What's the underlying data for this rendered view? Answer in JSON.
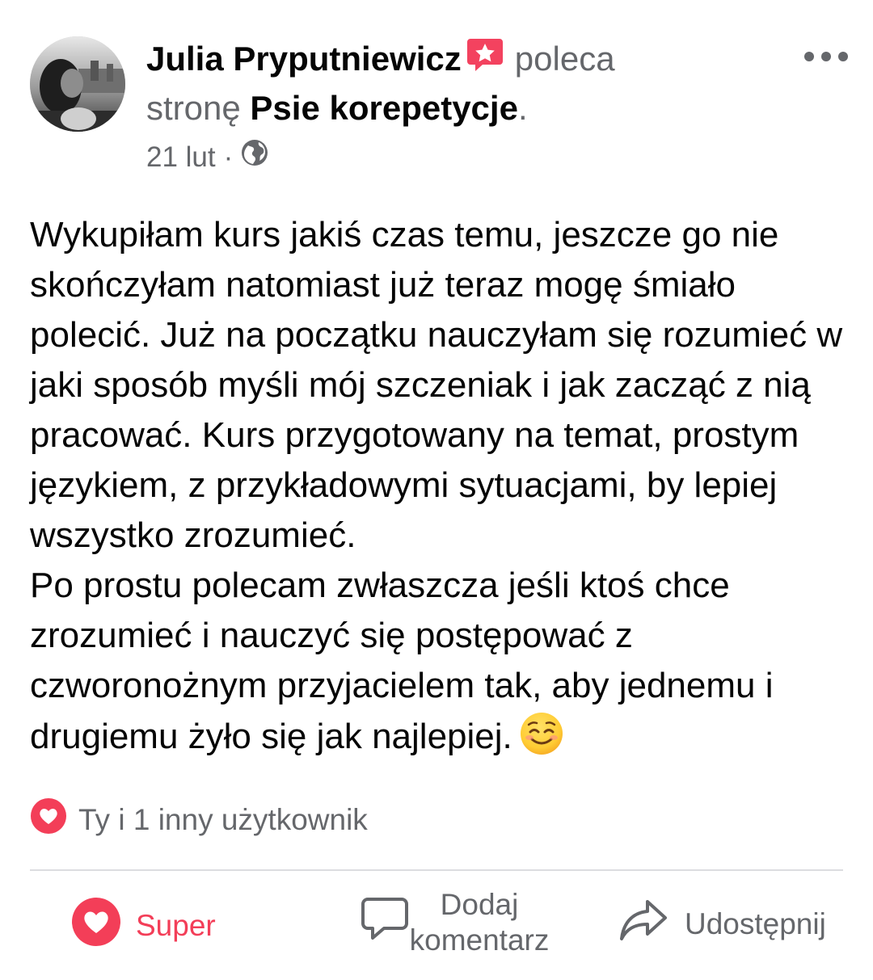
{
  "post": {
    "author_name": "Julia Pryputniewicz",
    "recommends_text": "poleca",
    "page_prefix": "stronę",
    "page_name": "Psie korepetycje",
    "page_suffix": ".",
    "date": "21 lut",
    "separator": "·",
    "audience_icon": "globe-icon",
    "paragraphs": [
      "Wykupiłam kurs jakiś czas temu, jeszcze go nie skończyłam natomiast już teraz mogę śmiało polecić. Już na początku nauczyłam się rozumieć w jaki sposób myśli mój szczeniak i jak zacząć z nią pracować. Kurs przygotowany na temat, prostym językiem, z przykładowymi sytuacjami, by lepiej wszystko zrozumieć.",
      "Po prostu polecam zwłaszcza jeśli ktoś chce zrozumieć i nauczyć się postępować z czworonożnym przyjacielem tak, aby jednemu i drugiemu żyło się jak najlepiej."
    ],
    "emoji": "smiling-face-icon"
  },
  "reactions": {
    "icon": "heart-icon",
    "summary": "Ty i 1 inny użytkownik"
  },
  "actions": {
    "like_label": "Super",
    "comment_label_line1": "Dodaj",
    "comment_label_line2": "komentarz",
    "share_label": "Udostępnij"
  },
  "colors": {
    "love": "#f33e58",
    "secondary_text": "#65676b",
    "primary_text": "#050505",
    "divider": "#dcdde0"
  }
}
